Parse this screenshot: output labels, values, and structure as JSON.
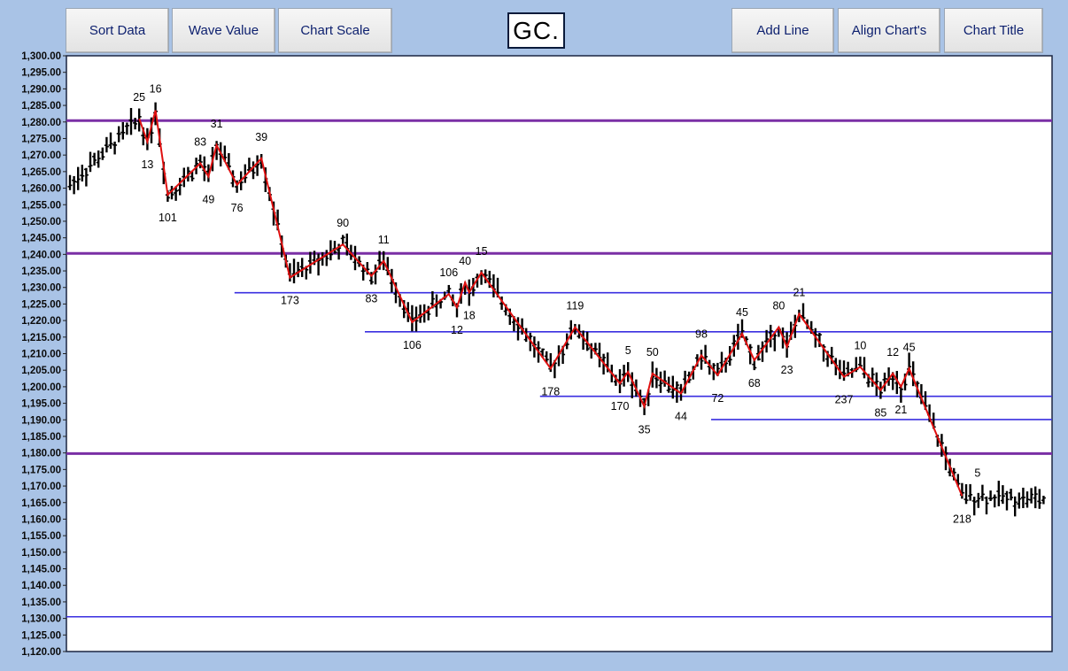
{
  "toolbar": {
    "sort_data": "Sort Data",
    "wave_value": "Wave Value",
    "chart_scale": "Chart Scale",
    "symbol": "GC.",
    "add_line": "Add Line",
    "align_charts": "Align Chart's",
    "chart_title": "Chart Title"
  },
  "colors": {
    "background": "#a9c3e6",
    "plot_background": "#ffffff",
    "bars": "#000000",
    "wave_line": "#e01010",
    "major_level": "#7a2fa5",
    "minor_level": "#3a2fe0"
  },
  "chart_data": {
    "type": "ohlc",
    "title": "",
    "xlabel": "",
    "ylabel": "",
    "ylim": [
      1120,
      1300
    ],
    "y_ticks": [
      "1,300.00",
      "1,295.00",
      "1,290.00",
      "1,285.00",
      "1,280.00",
      "1,275.00",
      "1,270.00",
      "1,265.00",
      "1,260.00",
      "1,255.00",
      "1,250.00",
      "1,245.00",
      "1,240.00",
      "1,235.00",
      "1,230.00",
      "1,225.00",
      "1,220.00",
      "1,215.00",
      "1,210.00",
      "1,205.00",
      "1,200.00",
      "1,195.00",
      "1,190.00",
      "1,185.00",
      "1,180.00",
      "1,175.00",
      "1,170.00",
      "1,165.00",
      "1,160.00",
      "1,155.00",
      "1,150.00",
      "1,145.00",
      "1,140.00",
      "1,135.00",
      "1,130.00",
      "1,125.00",
      "1,120.00"
    ],
    "bar_count": 240,
    "grid": false,
    "major_levels": [
      1280.4,
      1240.3,
      1179.8
    ],
    "minor_levels": [
      {
        "y": 1228.4,
        "from_bar": 43
      },
      {
        "y": 1216.6,
        "from_bar": 75
      },
      {
        "y": 1197.1,
        "from_bar": 118
      },
      {
        "y": 1190.1,
        "from_bar": 160
      },
      {
        "y": 1130.5,
        "from_bar": 0
      }
    ],
    "wave": [
      {
        "bar": 17,
        "y": 1281.0,
        "label": "25",
        "pos": "above"
      },
      {
        "bar": 19,
        "y": 1274.0,
        "label": "13",
        "pos": "below"
      },
      {
        "bar": 21,
        "y": 1283.5,
        "label": "16",
        "pos": "above"
      },
      {
        "bar": 24,
        "y": 1258.0,
        "label": "101",
        "pos": "below"
      },
      {
        "bar": 32,
        "y": 1267.5,
        "label": "83",
        "pos": "above"
      },
      {
        "bar": 34,
        "y": 1263.5,
        "label": "49",
        "pos": "below"
      },
      {
        "bar": 36,
        "y": 1273.0,
        "label": "31",
        "pos": "above"
      },
      {
        "bar": 41,
        "y": 1261.0,
        "label": "76",
        "pos": "below"
      },
      {
        "bar": 47,
        "y": 1269.0,
        "label": "39",
        "pos": "above"
      },
      {
        "bar": 54,
        "y": 1233.0,
        "label": "173",
        "pos": "below"
      },
      {
        "bar": 67,
        "y": 1243.0,
        "label": "90",
        "pos": "above"
      },
      {
        "bar": 74,
        "y": 1233.5,
        "label": "83",
        "pos": "below"
      },
      {
        "bar": 77,
        "y": 1238.0,
        "label": "11",
        "pos": "above"
      },
      {
        "bar": 84,
        "y": 1219.5,
        "label": "106",
        "pos": "below"
      },
      {
        "bar": 93,
        "y": 1228.0,
        "label": "106",
        "pos": "above"
      },
      {
        "bar": 95,
        "y": 1224.0,
        "label": "12",
        "pos": "below"
      },
      {
        "bar": 97,
        "y": 1231.5,
        "label": "40",
        "pos": "above"
      },
      {
        "bar": 98,
        "y": 1228.5,
        "label": "18",
        "pos": "below"
      },
      {
        "bar": 101,
        "y": 1234.5,
        "label": "15",
        "pos": "above"
      },
      {
        "bar": 118,
        "y": 1205.5,
        "label": "178",
        "pos": "below"
      },
      {
        "bar": 124,
        "y": 1218.0,
        "label": "119",
        "pos": "above"
      },
      {
        "bar": 135,
        "y": 1201.0,
        "label": "170",
        "pos": "below"
      },
      {
        "bar": 137,
        "y": 1204.5,
        "label": "5",
        "pos": "above"
      },
      {
        "bar": 141,
        "y": 1194.0,
        "label": "35",
        "pos": "below"
      },
      {
        "bar": 143,
        "y": 1204.0,
        "label": "50",
        "pos": "above"
      },
      {
        "bar": 150,
        "y": 1198.0,
        "label": "44",
        "pos": "below"
      },
      {
        "bar": 155,
        "y": 1209.5,
        "label": "98",
        "pos": "above"
      },
      {
        "bar": 159,
        "y": 1203.5,
        "label": "72",
        "pos": "below"
      },
      {
        "bar": 165,
        "y": 1216.0,
        "label": "45",
        "pos": "above"
      },
      {
        "bar": 168,
        "y": 1208.0,
        "label": "68",
        "pos": "below"
      },
      {
        "bar": 174,
        "y": 1218.0,
        "label": "80",
        "pos": "above"
      },
      {
        "bar": 176,
        "y": 1212.0,
        "label": "23",
        "pos": "below"
      },
      {
        "bar": 179,
        "y": 1222.0,
        "label": "21",
        "pos": "above"
      },
      {
        "bar": 190,
        "y": 1203.0,
        "label": "237",
        "pos": "below"
      },
      {
        "bar": 194,
        "y": 1206.0,
        "label": "10",
        "pos": "above"
      },
      {
        "bar": 199,
        "y": 1199.0,
        "label": "85",
        "pos": "below"
      },
      {
        "bar": 202,
        "y": 1204.0,
        "label": "12",
        "pos": "above"
      },
      {
        "bar": 204,
        "y": 1200.0,
        "label": "21",
        "pos": "below"
      },
      {
        "bar": 206,
        "y": 1205.5,
        "label": "45",
        "pos": "above"
      },
      {
        "bar": 219,
        "y": 1167.0,
        "label": "218",
        "pos": "below"
      },
      {
        "bar": 219,
        "y": 1167.0,
        "label": "5",
        "pos": "right"
      }
    ]
  }
}
